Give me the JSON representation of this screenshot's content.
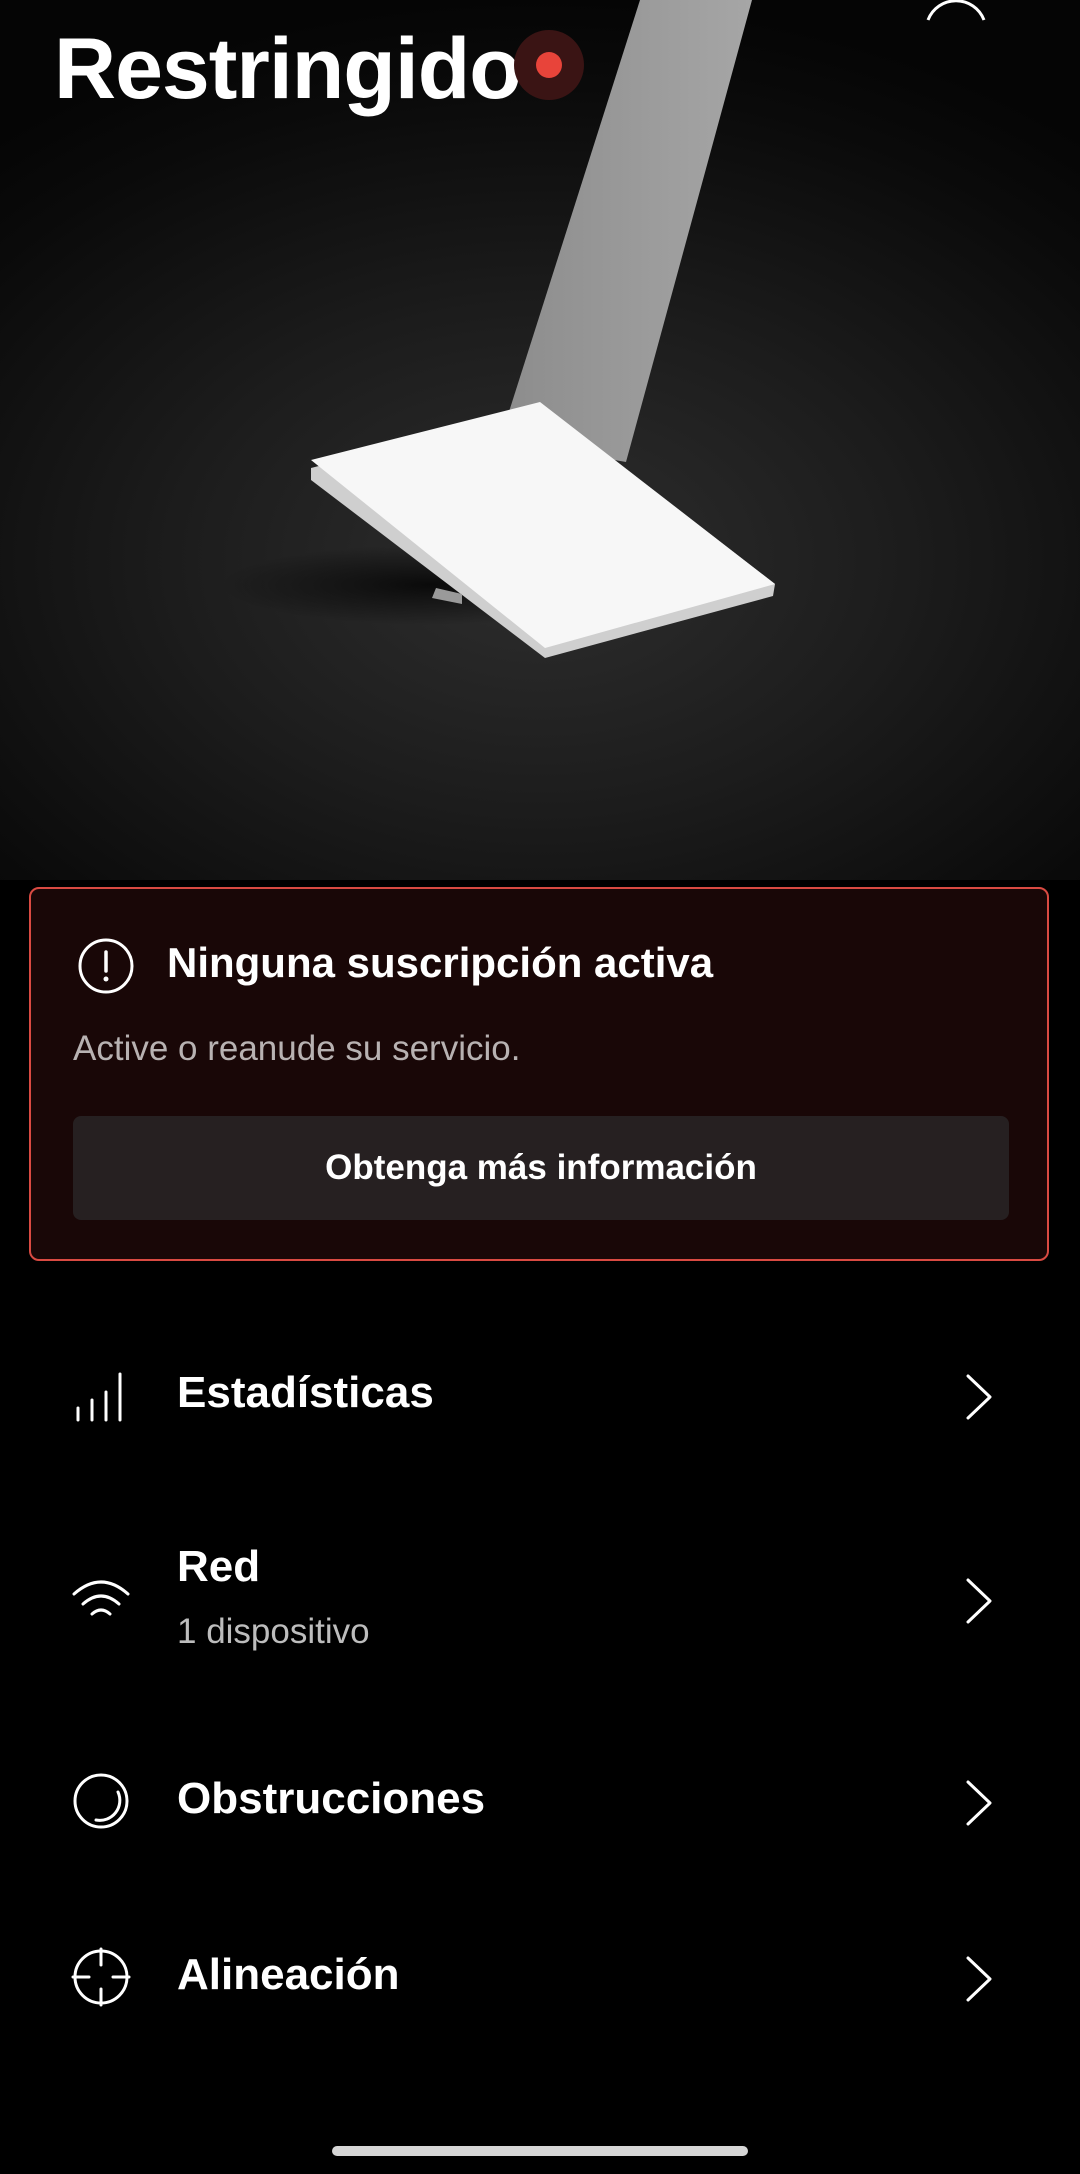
{
  "header": {
    "title": "Restringido",
    "status_color": "#e8443a",
    "status_icon": "status-dot-icon",
    "profile_icon": "profile-arc-icon"
  },
  "hero": {
    "image": "starlink-dish-illustration"
  },
  "alert": {
    "icon": "exclamation-circle-icon",
    "title": "Ninguna suscripción activa",
    "description": "Active o reanude su servicio.",
    "button_label": "Obtenga más información",
    "border_color": "#d94a42"
  },
  "menu": {
    "items": [
      {
        "label": "Estadísticas",
        "sublabel": "",
        "icon": "bar-chart-icon"
      },
      {
        "label": "Red",
        "sublabel": "1 dispositivo",
        "icon": "wifi-icon"
      },
      {
        "label": "Obstrucciones",
        "sublabel": "",
        "icon": "obstruction-icon"
      },
      {
        "label": "Alineación",
        "sublabel": "",
        "icon": "crosshair-icon"
      }
    ],
    "chevron_icon": "chevron-right-icon"
  }
}
